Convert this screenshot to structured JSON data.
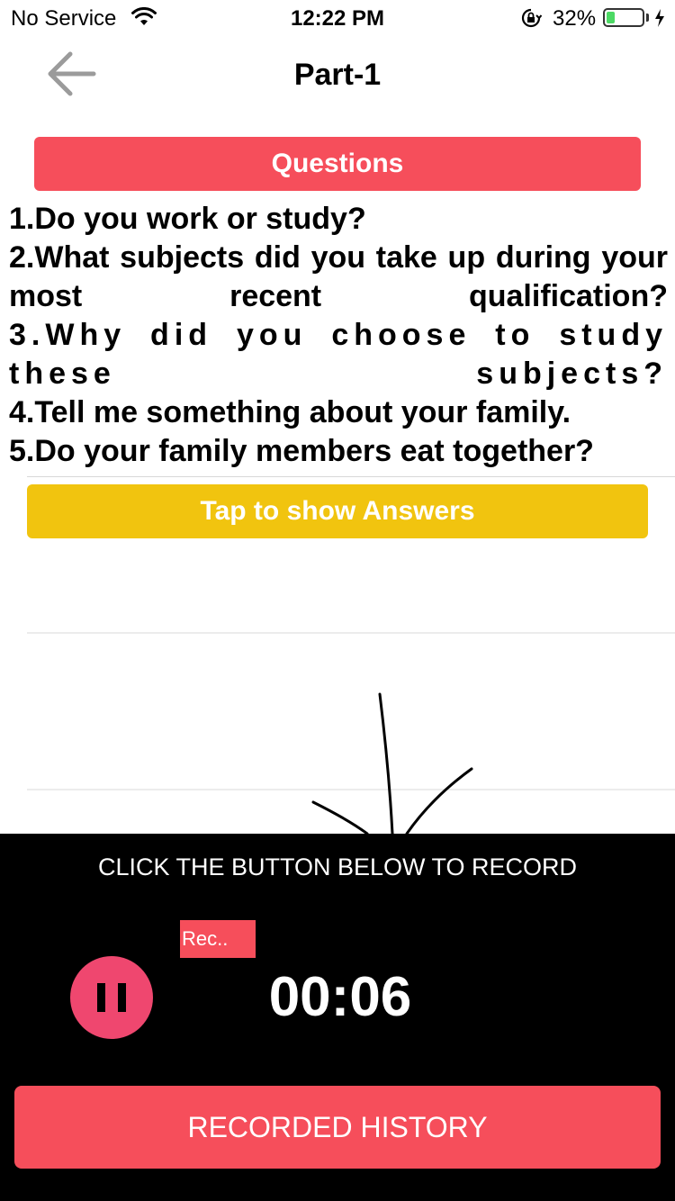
{
  "status_bar": {
    "carrier": "No Service",
    "time": "12:22 PM",
    "battery_percent": "32%",
    "battery_level": 0.32,
    "icons": [
      "wifi-icon",
      "orientation-lock-icon",
      "battery-icon",
      "charging-bolt-icon"
    ],
    "battery_color": "#4cd964"
  },
  "nav": {
    "back_icon": "arrow-left-icon",
    "title": "Part-1"
  },
  "questions_header": "Questions",
  "questions": [
    "1.Do you work or study?",
    "2.What subjects did you take up during your most recent qualification?",
    "3.Why did you choose to study these subjects?",
    "4.Tell me something about your family.",
    "5.Do your family members eat together?"
  ],
  "answers_button": "Tap to show Answers",
  "record_panel": {
    "instruction": "CLICK THE BUTTON BELOW TO RECORD",
    "rec_label": "Rec..",
    "timer": "00:06",
    "pause_icon": "pause-icon",
    "history_button": "RECORDED HISTORY"
  },
  "colors": {
    "primary_red": "#f64e5b",
    "answers_yellow": "#f1c40f",
    "pause_pink": "#ef476f",
    "panel_black": "#000000"
  }
}
